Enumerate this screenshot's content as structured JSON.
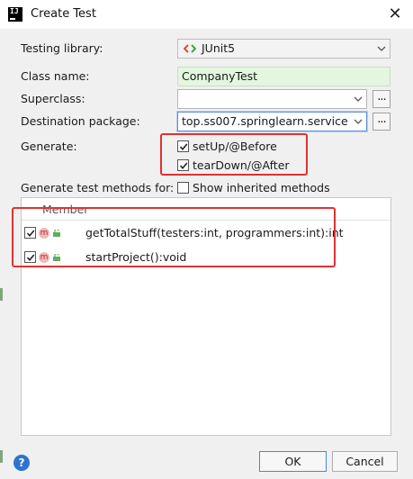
{
  "window": {
    "title": "Create Test",
    "close_glyph": "✕"
  },
  "form": {
    "testing_library": {
      "label": "Testing library:",
      "value": "JUnit5"
    },
    "class_name": {
      "label": "Class name:",
      "value": "CompanyTest"
    },
    "superclass": {
      "label": "Superclass:",
      "value": ""
    },
    "destination_package": {
      "label": "Destination package:",
      "value": "top.ss007.springlearn.service"
    },
    "generate": {
      "label": "Generate:",
      "options": [
        {
          "label": "setUp/@Before",
          "checked": true
        },
        {
          "label": "tearDown/@After",
          "checked": true
        }
      ]
    },
    "methods_for": {
      "label": "Generate test methods for:"
    },
    "show_inherited": {
      "label": "Show inherited methods",
      "checked": false
    },
    "browse_glyph": "..."
  },
  "members": {
    "header": "Member",
    "icon_letter": "m",
    "rows": [
      {
        "signature": "getTotalStuff(testers:int, programmers:int):int",
        "checked": true
      },
      {
        "signature": "startProject():void",
        "checked": true
      }
    ]
  },
  "footer": {
    "help_glyph": "?",
    "ok_label": "OK",
    "cancel_label": "Cancel"
  },
  "colors": {
    "highlight": "#e03131",
    "accent": "#2f73cf",
    "valid_field": "#e3f6df"
  }
}
